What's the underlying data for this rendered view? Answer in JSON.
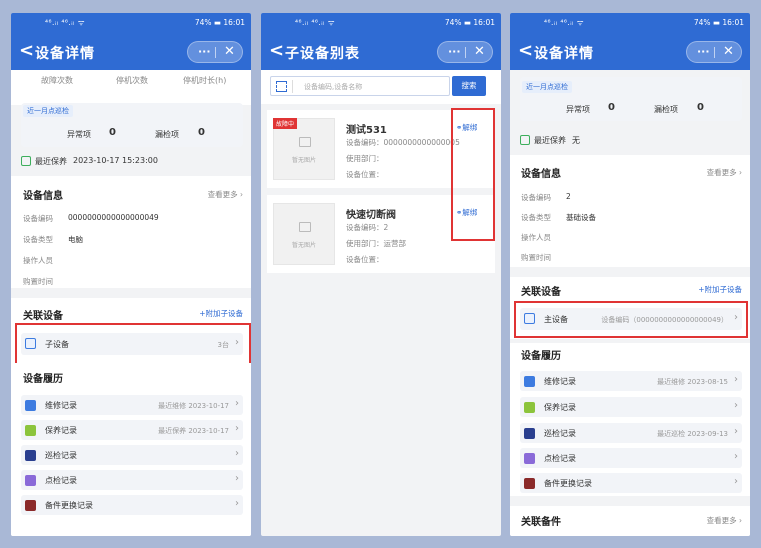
{
  "status_bar": {
    "signal": "⁴⁶.ᵢₗ ⁴⁶.ᵢₗ ᯤ",
    "battery": "74%",
    "time": "16:01"
  },
  "nav": {
    "back": "<",
    "more": "···",
    "close": "✕"
  },
  "screen1": {
    "title": "设备详情",
    "stats_headers": [
      "故障次数",
      "停机次数",
      "停机时长(h)"
    ],
    "inspection_tag": "近一月点巡检",
    "abnormal_label": "异常项",
    "abnormal_value": "0",
    "missed_label": "漏检项",
    "missed_value": "0",
    "maintenance_label": "最近保养",
    "maintenance_value": "2023-10-17 15:23:00",
    "info_title": "设备信息",
    "info_more": "查看更多",
    "info_fields": [
      {
        "label": "设备编码",
        "value": "0000000000000000049"
      },
      {
        "label": "设备类型",
        "value": "电脑"
      },
      {
        "label": "操作人员",
        "value": ""
      },
      {
        "label": "购置时间",
        "value": ""
      }
    ],
    "related_title": "关联设备",
    "add_child": "+附加子设备",
    "child_label": "子设备",
    "child_count": "3台",
    "history_title": "设备履历",
    "history": [
      {
        "label": "维修记录",
        "right": "最近维修 2023-10-17",
        "color": "#3d7be0"
      },
      {
        "label": "保养记录",
        "right": "最近保养 2023-10-17",
        "color": "#8cc43c"
      },
      {
        "label": "巡检记录",
        "right": "",
        "color": "#2a3f8f"
      },
      {
        "label": "点检记录",
        "right": "",
        "color": "#8a6ad8"
      },
      {
        "label": "备件更换记录",
        "right": "",
        "color": "#8b2a2a"
      }
    ]
  },
  "screen2": {
    "title": "子设备别表",
    "search_placeholder": "设备编码,设备名称",
    "search_button": "搜索",
    "items": [
      {
        "name": "测试531",
        "badge": "故障中",
        "code_label": "设备编码：",
        "code": "0000000000000005",
        "dept_label": "使用部门：",
        "dept": "",
        "loc_label": "设备位置：",
        "loc": "",
        "unbind": "解绑",
        "no_image": "暂无图片"
      },
      {
        "name": "快速切断阀",
        "badge": "",
        "code_label": "设备编码：",
        "code": "2",
        "dept_label": "使用部门：",
        "dept": "运营部",
        "loc_label": "设备位置：",
        "loc": "",
        "unbind": "解绑",
        "no_image": "暂无图片"
      }
    ]
  },
  "screen3": {
    "title": "设备详情",
    "inspection_tag": "近一月点巡检",
    "abnormal_label": "异常项",
    "abnormal_value": "0",
    "missed_label": "漏检项",
    "missed_value": "0",
    "maintenance_label": "最近保养",
    "maintenance_value": "无",
    "info_title": "设备信息",
    "info_more": "查看更多",
    "info_fields": [
      {
        "label": "设备编码",
        "value": "2"
      },
      {
        "label": "设备类型",
        "value": "基础设备"
      },
      {
        "label": "操作人员",
        "value": ""
      },
      {
        "label": "购置时间",
        "value": ""
      }
    ],
    "related_title": "关联设备",
    "add_child": "+附加子设备",
    "main_label": "主设备",
    "main_code": "设备编码（0000000000000000049）",
    "history_title": "设备履历",
    "history": [
      {
        "label": "维修记录",
        "right": "最近维修 2023-08-15",
        "color": "#3d7be0"
      },
      {
        "label": "保养记录",
        "right": "",
        "color": "#8cc43c"
      },
      {
        "label": "巡检记录",
        "right": "最近巡检 2023-09-13",
        "color": "#2a3f8f"
      },
      {
        "label": "点检记录",
        "right": "",
        "color": "#8a6ad8"
      },
      {
        "label": "备件更换记录",
        "right": "",
        "color": "#8b2a2a"
      }
    ],
    "spares_title": "关联备件",
    "spares_more": "查看更多"
  }
}
